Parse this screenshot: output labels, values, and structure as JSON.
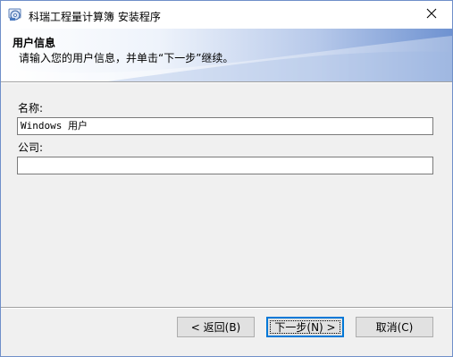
{
  "window": {
    "title": "科瑞工程量计算簿 安装程序",
    "app_icon": "setup-disc-icon",
    "close_icon": "close-icon"
  },
  "banner": {
    "title": "用户信息",
    "subtitle": "请输入您的用户信息，并单击“下一步”继续。"
  },
  "form": {
    "name_label": "名称:",
    "name_value": "Windows 用户",
    "company_label": "公司:",
    "company_value": ""
  },
  "buttons": {
    "back": "< 返回(B)",
    "next": "下一步(N) >",
    "cancel": "取消(C)"
  },
  "colors": {
    "accent": "#0078d7",
    "banner_gradient_end": "#6e92d1"
  }
}
